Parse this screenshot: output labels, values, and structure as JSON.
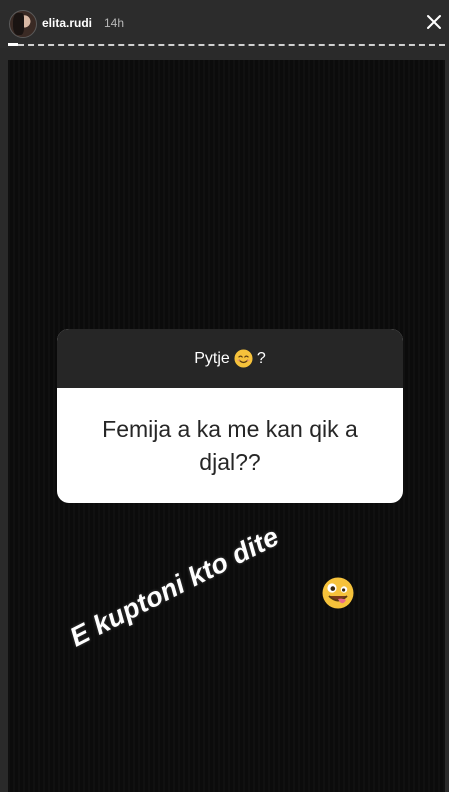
{
  "header": {
    "username": "elita.rudi",
    "time": "14h",
    "close_icon": "close-icon",
    "avatar_icon": "avatar"
  },
  "question_card": {
    "title": "Pytje",
    "title_emoji_icon": "smiling-face-icon",
    "title_suffix": "?",
    "question": "Femija a ka me kan qik a djal??",
    "header_color": "#262626",
    "body_color": "#ffffff"
  },
  "sticker": {
    "text": "E kuptoni kto dite",
    "emoji_icon": "zany-face-icon"
  },
  "colors": {
    "story_background": "#0b0b0b",
    "header_background": "#2c2c2c"
  }
}
